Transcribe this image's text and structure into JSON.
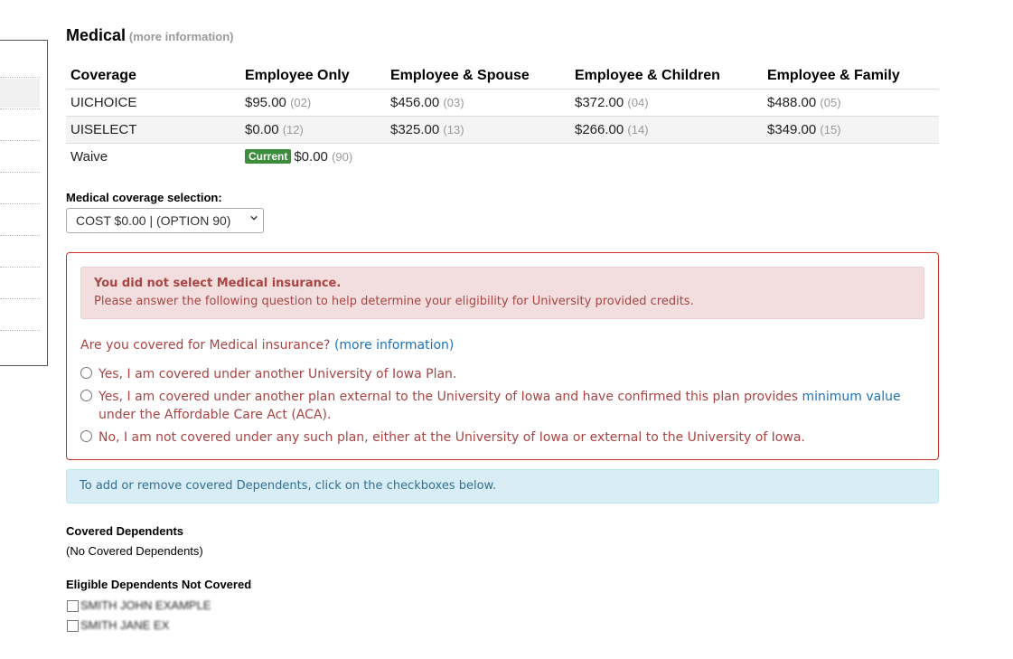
{
  "section": {
    "title": "Medical",
    "more_info": "(more information)"
  },
  "table": {
    "headers": [
      "Coverage",
      "Employee Only",
      "Employee & Spouse",
      "Employee & Children",
      "Employee & Family"
    ],
    "rows": [
      {
        "plan": "UICHOICE",
        "cells": [
          {
            "price": "$95.00",
            "code": "(02)"
          },
          {
            "price": "$456.00",
            "code": "(03)"
          },
          {
            "price": "$372.00",
            "code": "(04)"
          },
          {
            "price": "$488.00",
            "code": "(05)"
          }
        ]
      },
      {
        "plan": "UISELECT",
        "cells": [
          {
            "price": "$0.00",
            "code": "(12)"
          },
          {
            "price": "$325.00",
            "code": "(13)"
          },
          {
            "price": "$266.00",
            "code": "(14)"
          },
          {
            "price": "$349.00",
            "code": "(15)"
          }
        ]
      },
      {
        "plan": "Waive",
        "badge": "Current",
        "cells": [
          {
            "price": "$0.00",
            "code": "(90)"
          }
        ]
      }
    ]
  },
  "selection": {
    "label": "Medical coverage selection:",
    "value": "COST $0.00 | (OPTION 90)"
  },
  "warning": {
    "heading": "You did not select Medical insurance.",
    "body": "Please answer the following question to help determine your eligibility for University provided credits."
  },
  "question": {
    "text": "Are you covered for Medical insurance?",
    "link": "(more information)",
    "options": [
      {
        "text": "Yes, I am covered under another University of Iowa Plan."
      },
      {
        "text_before": "Yes, I am covered under another plan external to the University of Iowa and have confirmed this plan provides",
        "link": "minimum value",
        "text_after": "under the Affordable Care Act (ACA)."
      },
      {
        "text": "No, I am not covered under any such plan, either at the University of Iowa or external to the University of Iowa."
      }
    ]
  },
  "info": {
    "text": "To add or remove covered Dependents, click on the checkboxes below."
  },
  "covered": {
    "heading": "Covered Dependents",
    "empty": "(No Covered Dependents)"
  },
  "eligible": {
    "heading": "Eligible Dependents Not Covered",
    "items": [
      "SMITH JOHN EXAMPLE",
      "SMITH JANE EX"
    ]
  }
}
